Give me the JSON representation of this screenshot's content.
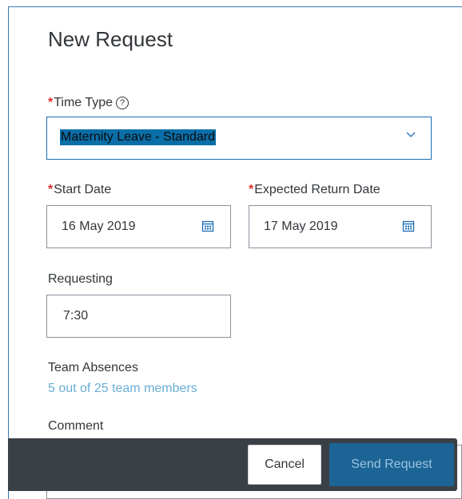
{
  "dialog": {
    "title": "New Request"
  },
  "time_type": {
    "required_mark": "*",
    "label": "Time Type",
    "help_icon": "?",
    "value": "Maternity Leave - Standard"
  },
  "start_date": {
    "required_mark": "*",
    "label": "Start Date",
    "value": "16 May 2019"
  },
  "return_date": {
    "required_mark": "*",
    "label": "Expected Return Date",
    "value": "17 May 2019"
  },
  "requesting": {
    "label": "Requesting",
    "value": "7:30"
  },
  "team_absences": {
    "label": "Team Absences",
    "link": "5 out of 25 team members"
  },
  "comment": {
    "label": "Comment"
  },
  "footer": {
    "cancel_label": "Cancel",
    "send_label": "Send Request"
  },
  "colors": {
    "accent": "#0a6ea8",
    "required": "#e03030",
    "link": "#6aaed6",
    "footer_bg": "#3a4046",
    "send_button_bg": "#1c6495"
  },
  "icons": {
    "help": "help-circle-icon",
    "dropdown": "chevron-down-icon",
    "calendar": "calendar-icon"
  }
}
